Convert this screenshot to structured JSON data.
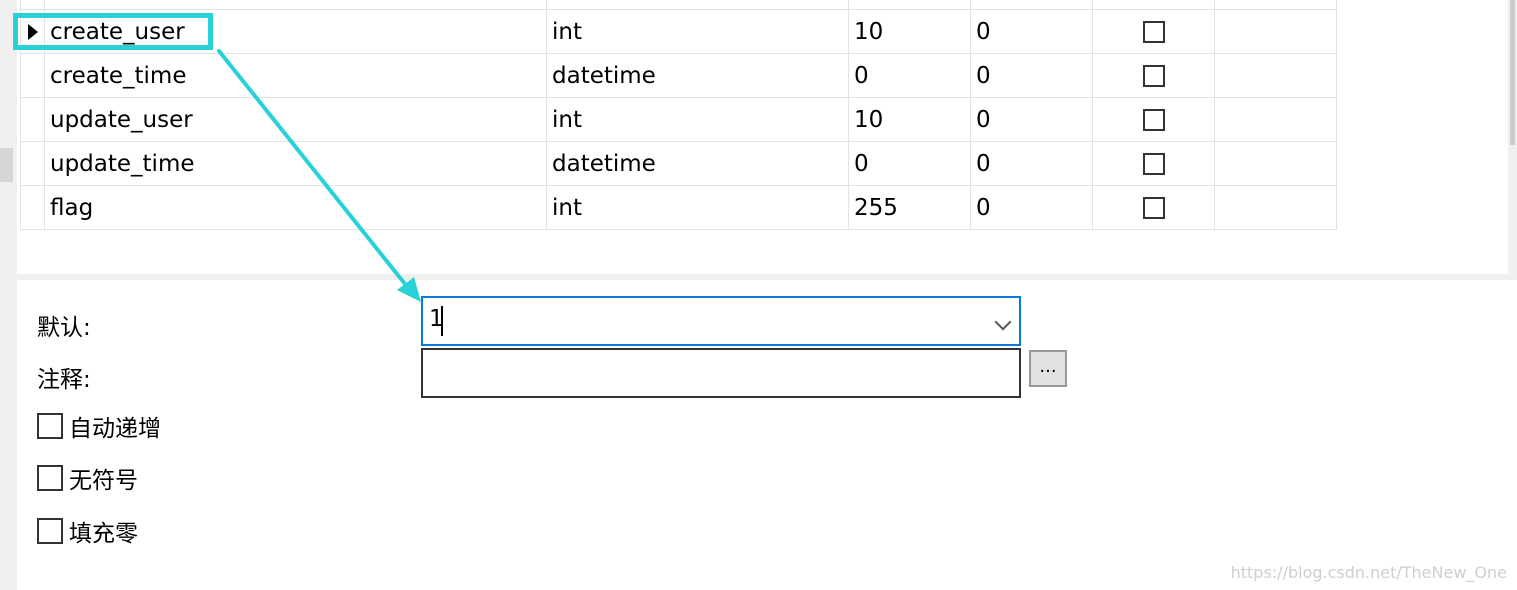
{
  "fields": [
    {
      "name": "create_user",
      "type": "int",
      "length": "10",
      "decimals": "0",
      "not_null": false,
      "extra": "",
      "selected": true
    },
    {
      "name": "create_time",
      "type": "datetime",
      "length": "0",
      "decimals": "0",
      "not_null": false,
      "extra": "",
      "selected": false
    },
    {
      "name": "update_user",
      "type": "int",
      "length": "10",
      "decimals": "0",
      "not_null": false,
      "extra": "",
      "selected": false
    },
    {
      "name": "update_time",
      "type": "datetime",
      "length": "0",
      "decimals": "0",
      "not_null": false,
      "extra": "",
      "selected": false
    },
    {
      "name": "flag",
      "type": "int",
      "length": "255",
      "decimals": "0",
      "not_null": false,
      "extra": "",
      "selected": false
    }
  ],
  "properties": {
    "default_label": "默认:",
    "default_value": "1",
    "comment_label": "注释:",
    "comment_value": "",
    "comment_button": "...",
    "options": [
      {
        "label": "自动递增",
        "checked": false
      },
      {
        "label": "无符号",
        "checked": false
      },
      {
        "label": "填充零",
        "checked": false
      }
    ]
  },
  "colors": {
    "annotation": "#29d1d6",
    "focus_border": "#0a7ad6"
  },
  "watermark": "https://blog.csdn.net/TheNew_One"
}
